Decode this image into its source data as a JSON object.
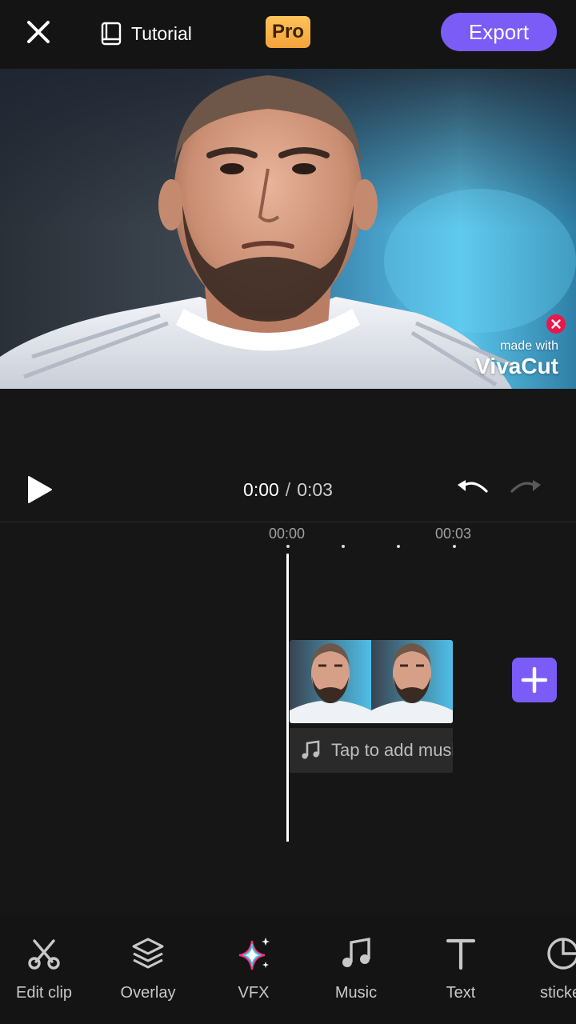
{
  "topbar": {
    "close_icon": "close-icon",
    "tutorial_label": "Tutorial",
    "tutorial_icon": "book-icon",
    "pro_label": "Pro",
    "export_label": "Export"
  },
  "preview": {
    "watermark_made_with": "made with",
    "watermark_brand": "VivaCut",
    "watermark_close_icon": "close-icon"
  },
  "player": {
    "current_time": "0:00",
    "separator": "/",
    "total_time": "0:03",
    "play_icon": "play-icon",
    "undo_icon": "undo-icon",
    "redo_icon": "redo-icon"
  },
  "timeline": {
    "ruler_start": "00:00",
    "ruler_end": "00:03",
    "music_prompt": "Tap to add music",
    "music_icon": "music-note-icon",
    "add_icon": "plus-icon"
  },
  "toolbar": {
    "items": [
      {
        "label": "Edit clip",
        "icon": "scissors-icon"
      },
      {
        "label": "Overlay",
        "icon": "layers-icon"
      },
      {
        "label": "VFX",
        "icon": "sparkle-icon"
      },
      {
        "label": "Music",
        "icon": "music-note-icon"
      },
      {
        "label": "Text",
        "icon": "text-icon"
      },
      {
        "label": "sticker",
        "icon": "sticker-icon"
      }
    ]
  },
  "colors": {
    "accent": "#7b5cf6",
    "pro_badge": "#f4a23a",
    "background": "#161616",
    "watermark_close": "#e8194a"
  }
}
